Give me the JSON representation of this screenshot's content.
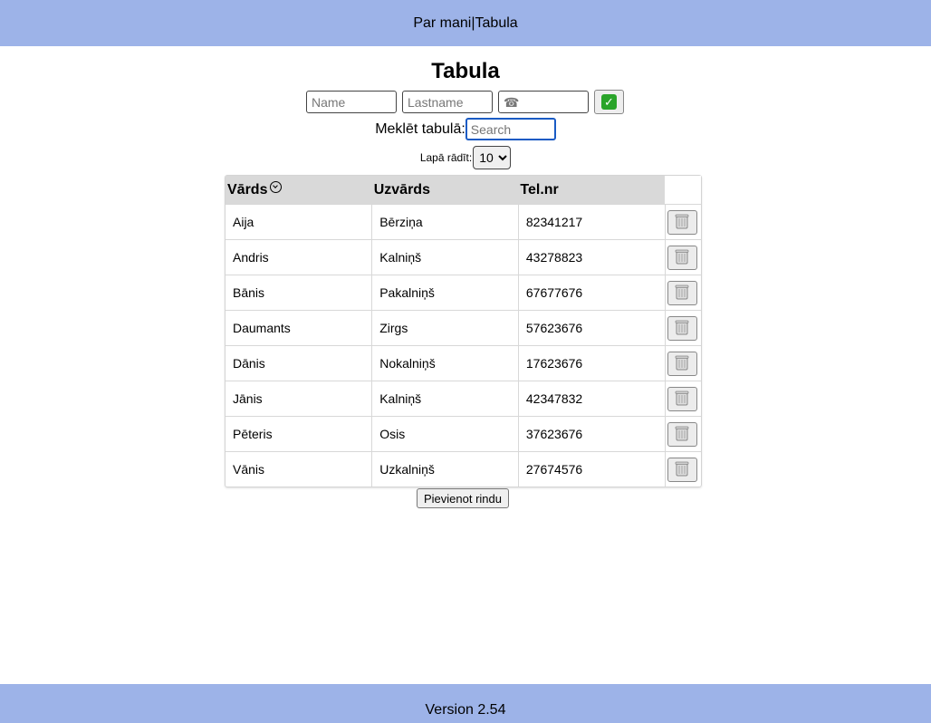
{
  "nav": {
    "about_label": "Par mani",
    "separator": " |",
    "table_label": "Tabula"
  },
  "page": {
    "title": "Tabula"
  },
  "add_form": {
    "name_placeholder": "Name",
    "lastname_placeholder": "Lastname",
    "phone_placeholder": "☎",
    "confirm_icon": "check-mark-icon"
  },
  "search": {
    "label": "Meklēt tabulā:",
    "placeholder": "Search",
    "value": ""
  },
  "per_page": {
    "label": "Lapā rādīt:",
    "selected": "10"
  },
  "table": {
    "headers": [
      "Vārds",
      "Uzvārds",
      "Tel.nr",
      ""
    ],
    "sort_icon": "chevron-circle-down-icon",
    "rows": [
      {
        "first": "Aija",
        "last": "Bērziņa",
        "phone": "82341217"
      },
      {
        "first": "Andris",
        "last": "Kalniņš",
        "phone": "43278823"
      },
      {
        "first": "Bānis",
        "last": "Pakalniņš",
        "phone": "67677676"
      },
      {
        "first": "Daumants",
        "last": "Zirgs",
        "phone": "57623676"
      },
      {
        "first": "Dānis",
        "last": "Nokalniņš",
        "phone": "17623676"
      },
      {
        "first": "Jānis",
        "last": "Kalniņš",
        "phone": "42347832"
      },
      {
        "first": "Pēteris",
        "last": "Osis",
        "phone": "37623676"
      },
      {
        "first": "Vānis",
        "last": "Uzkalniņš",
        "phone": "27674576"
      }
    ],
    "delete_icon": "trash-icon"
  },
  "add_row_button": "Pievienot rindu",
  "footer": {
    "version": "Version 2.54"
  },
  "colors": {
    "bar_background": "#9db3e8",
    "header_row": "#d9d9d9",
    "confirm_green": "#2aa42a",
    "search_focus": "#1a5bc4"
  }
}
